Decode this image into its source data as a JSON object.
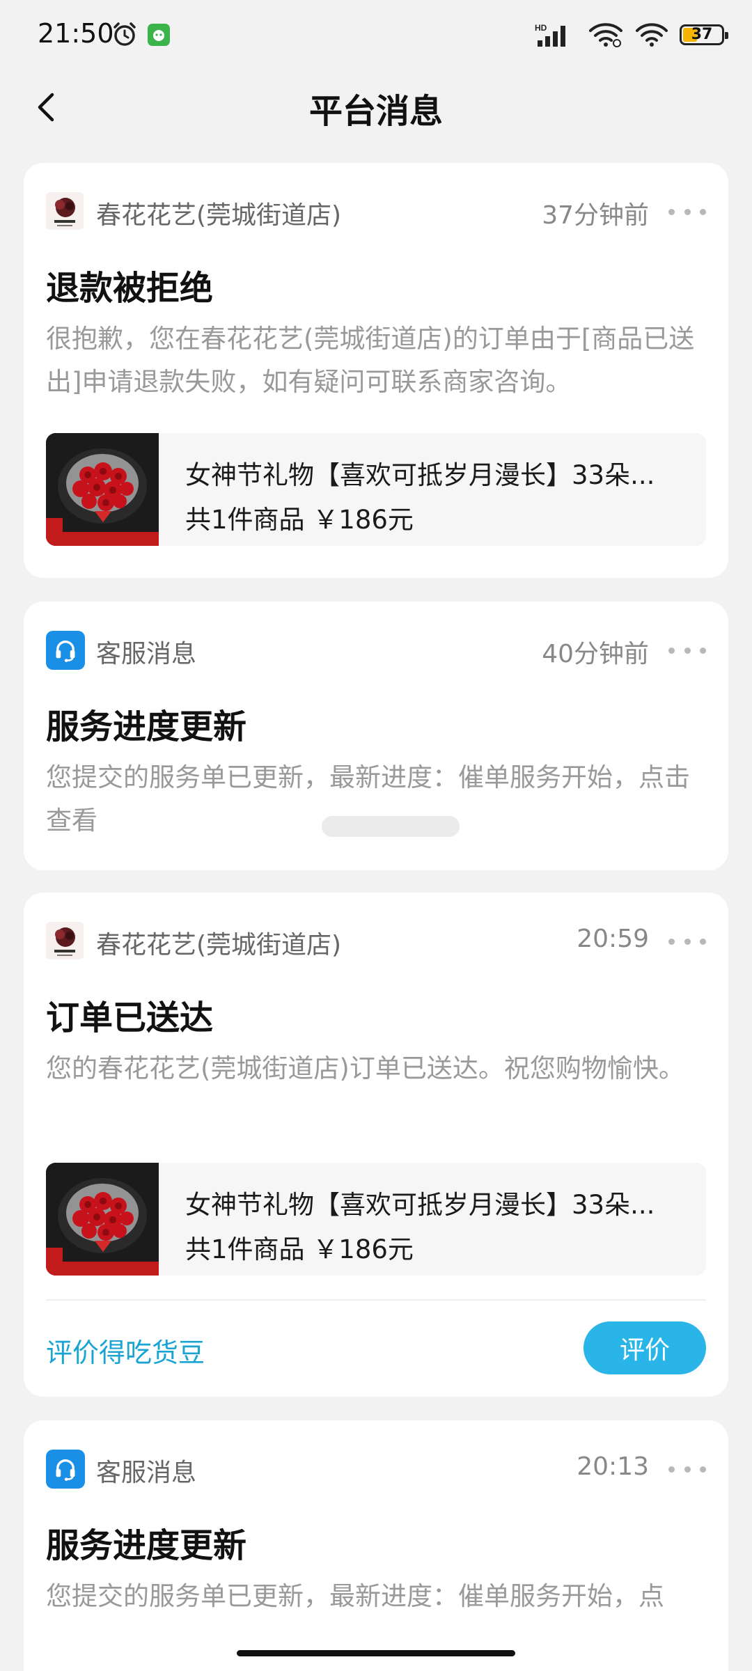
{
  "status_bar": {
    "time": "21:50",
    "network": "HD",
    "battery": "37",
    "battery_level": 0.37
  },
  "header": {
    "back_icon": "chevron-left-icon",
    "title": "平台消息"
  },
  "messages": [
    {
      "source_name": "春花花艺(莞城街道店)",
      "source_icon": "shop-avatar",
      "time": "37分钟前",
      "title": "退款被拒绝",
      "body": "很抱歉，您在春花花艺(莞城街道店)的订单由于[商品已送出]申请退款失败，如有疑问可联系商家咨询。",
      "product": {
        "name": "女神节礼物【喜欢可抵岁月漫长】33朵...",
        "meta": "共1件商品  ￥186元"
      }
    },
    {
      "source_name": "客服消息",
      "source_icon": "headset-icon",
      "time": "40分钟前",
      "title": "服务进度更新",
      "body": "您提交的服务单已更新，最新进度：催单服务开始，点击查看"
    },
    {
      "source_name": "春花花艺(莞城街道店)",
      "source_icon": "shop-avatar",
      "time": "20:59",
      "title": "订单已送达",
      "body": "您的春花花艺(莞城街道店)订单已送达。祝您购物愉快。",
      "product": {
        "name": "女神节礼物【喜欢可抵岁月漫长】33朵...",
        "meta": "共1件商品  ￥186元"
      },
      "review_link": "评价得吃货豆",
      "review_button": "评价"
    },
    {
      "source_name": "客服消息",
      "source_icon": "headset-icon",
      "time": "20:13",
      "title": "服务进度更新",
      "body": "您提交的服务单已更新，最新进度：催单服务开始，点"
    }
  ],
  "colors": {
    "background": "#f2f2f2",
    "card": "#ffffff",
    "accent": "#29b5e8",
    "link": "#19a4d3",
    "customer_service_icon": "#1a8fe6",
    "battery_fill": "#f5b400"
  }
}
